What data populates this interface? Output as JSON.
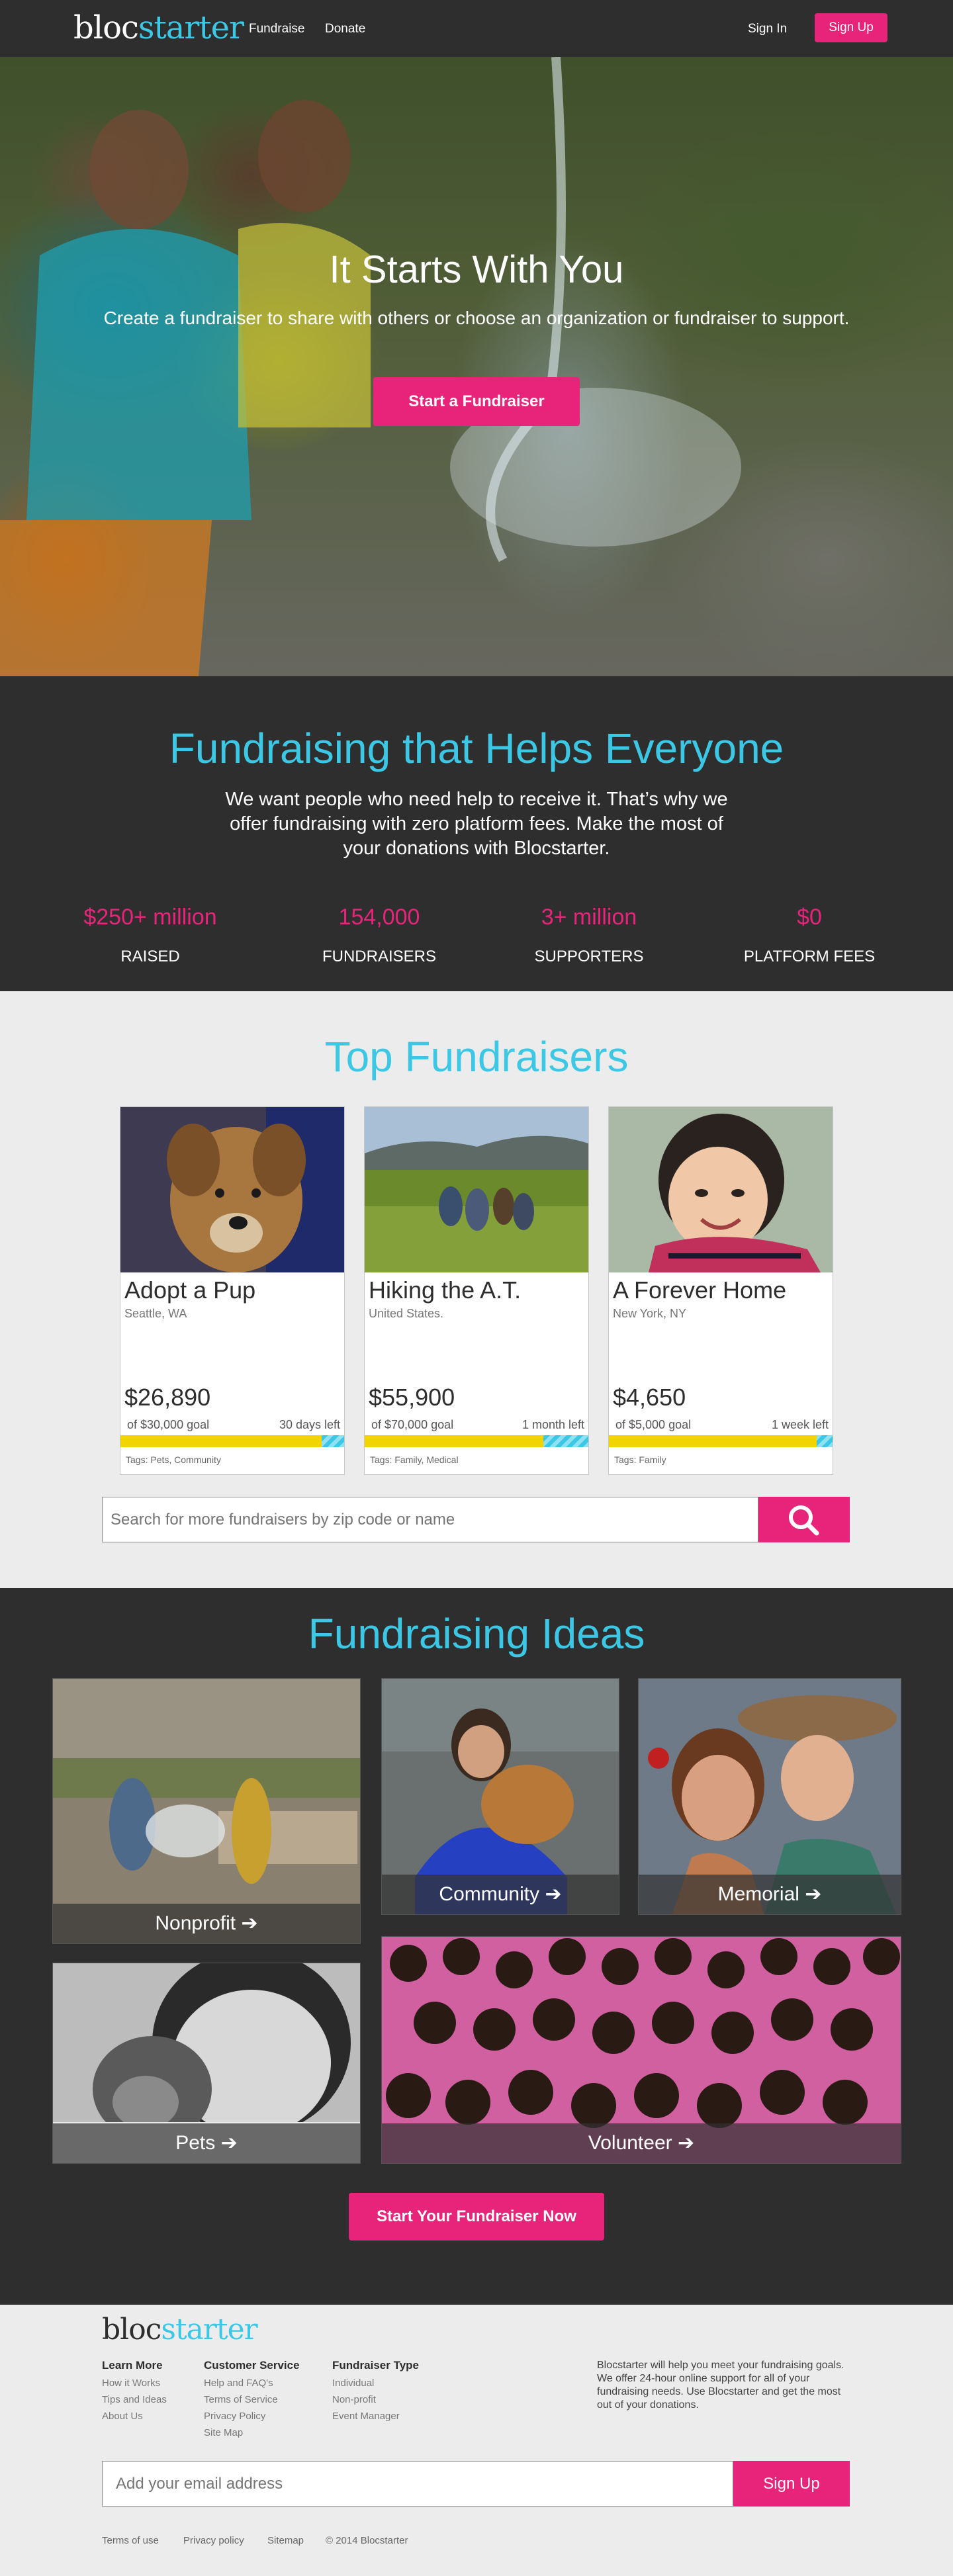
{
  "nav": {
    "logo_a": "bloc",
    "logo_b": "starter",
    "links": [
      "Fundraise",
      "Donate"
    ],
    "signin": "Sign In",
    "signup": "Sign Up"
  },
  "hero": {
    "title": "It Starts With You",
    "subtitle": "Create a fundraiser to share with others or choose an organization or fundraiser to support.",
    "button": "Start a Fundraiser"
  },
  "stats": {
    "title": "Fundraising that Helps Everyone",
    "description": "We want people who need help to receive it. That’s why we offer fundraising with zero platform fees. Make the most of your donations with Blocstarter.",
    "items": [
      {
        "value": "$250+ million",
        "label": "RAISED"
      },
      {
        "value": "154,000",
        "label": "FUNDRAISERS"
      },
      {
        "value": "3+ million",
        "label": "SUPPORTERS"
      },
      {
        "value": "$0",
        "label": "PLATFORM FEES"
      }
    ]
  },
  "top": {
    "title": "Top Fundraisers",
    "cards": [
      {
        "title": "Adopt a Pup",
        "location": "Seattle, WA",
        "amount": "$26,890",
        "goal": "of $30,000 goal",
        "time_left": "30 days left",
        "progress": 0.9,
        "tags": "Tags: Pets, Community"
      },
      {
        "title": "Hiking the A.T.",
        "location": "United States.",
        "amount": "$55,900",
        "goal": "of $70,000 goal",
        "time_left": "1 month left",
        "progress": 0.8,
        "tags": "Tags: Family, Medical"
      },
      {
        "title": "A Forever Home",
        "location": "New York, NY",
        "amount": "$4,650",
        "goal": "of $5,000 goal",
        "time_left": "1 week left",
        "progress": 0.93,
        "tags": "Tags: Family"
      }
    ],
    "search_placeholder": "Search for more fundraisers by zip code or name"
  },
  "ideas": {
    "title": "Fundraising Ideas",
    "tiles": [
      "Nonprofit",
      "Community",
      "Memorial",
      "Pets",
      "Volunteer"
    ],
    "button": "Start  Your Fundraiser Now"
  },
  "footer": {
    "logo_a": "bloc",
    "logo_b": "starter",
    "columns": [
      {
        "heading": "Learn More",
        "links": [
          "How it Works",
          "Tips and Ideas",
          "About Us"
        ]
      },
      {
        "heading": "Customer Service",
        "links": [
          "Help and FAQ's",
          "Terms of Service",
          "Privacy Policy",
          "Site Map"
        ]
      },
      {
        "heading": "Fundraiser Type",
        "links": [
          "Individual",
          "Non-profit",
          "Event Manager"
        ]
      }
    ],
    "about": "Blocstarter will help you meet your fundraising goals. We offer 24-hour online support for all of your fundraising needs. Use Blocstarter and get the most out of your donations.",
    "email_placeholder": "Add your email address",
    "signup": "Sign Up",
    "bottom_links": [
      "Terms of use",
      "Privacy policy",
      "Sitemap",
      "© 2014 Blocstarter"
    ]
  },
  "colors": {
    "accent": "#e8247a",
    "brand": "#3cc8e5",
    "dark": "#2e2e2e",
    "light": "#ececec"
  }
}
